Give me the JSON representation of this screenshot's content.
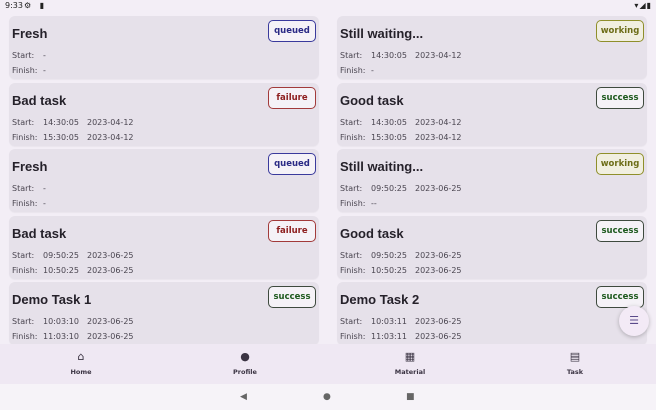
{
  "status_bar": {
    "time": "9:33"
  },
  "cards": [
    {
      "title": "Fresh",
      "status": "queued",
      "start_time": "-",
      "start_date": "",
      "finish_time": "-",
      "finish_date": ""
    },
    {
      "title": "Still waiting...",
      "status": "working",
      "start_time": "14:30:05",
      "start_date": "2023-04-12",
      "finish_time": "-",
      "finish_date": ""
    },
    {
      "title": "Bad task",
      "status": "failure",
      "start_time": "14:30:05",
      "start_date": "2023-04-12",
      "finish_time": "15:30:05",
      "finish_date": "2023-04-12"
    },
    {
      "title": "Good task",
      "status": "success",
      "start_time": "14:30:05",
      "start_date": "2023-04-12",
      "finish_time": "15:30:05",
      "finish_date": "2023-04-12"
    },
    {
      "title": "Fresh",
      "status": "queued",
      "start_time": "-",
      "start_date": "",
      "finish_time": "-",
      "finish_date": ""
    },
    {
      "title": "Still waiting...",
      "status": "working",
      "start_time": "09:50:25",
      "start_date": "2023-06-25",
      "finish_time": "--",
      "finish_date": ""
    },
    {
      "title": "Bad task",
      "status": "failure",
      "start_time": "09:50:25",
      "start_date": "2023-06-25",
      "finish_time": "10:50:25",
      "finish_date": "2023-06-25"
    },
    {
      "title": "Good task",
      "status": "success",
      "start_time": "09:50:25",
      "start_date": "2023-06-25",
      "finish_time": "10:50:25",
      "finish_date": "2023-06-25"
    },
    {
      "title": "Demo Task 1",
      "status": "success",
      "start_time": "10:03:10",
      "start_date": "2023-06-25",
      "finish_time": "11:03:10",
      "finish_date": "2023-06-25"
    },
    {
      "title": "Demo Task 2",
      "status": "success",
      "start_time": "10:03:11",
      "start_date": "2023-06-25",
      "finish_time": "11:03:11",
      "finish_date": "2023-06-25"
    }
  ],
  "labels": {
    "start": "Start:",
    "finish": "Finish:"
  },
  "nav": {
    "home": "Home",
    "profile": "Profile",
    "material": "Material",
    "task": "Task"
  },
  "icons": {
    "home": "home-icon",
    "profile": "person-icon",
    "material": "grid-icon",
    "task": "task-icon",
    "fab": "filter-icon"
  }
}
